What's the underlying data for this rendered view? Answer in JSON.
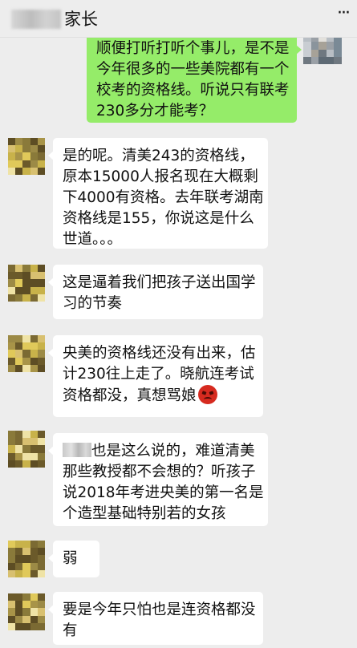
{
  "header": {
    "title": "家长",
    "more_label": "···"
  },
  "messages": [
    {
      "type": "sent",
      "lines": [
        "顺便打听打听个事儿，是不是",
        "今年很多的一些美院都有一个",
        "校考的资格线。听说只有联考",
        "230多分才能考？"
      ]
    },
    {
      "type": "received",
      "lines": [
        "是的呢。清美243的资格线，",
        "原本15000人报名现在大概剩",
        "下4000有资格。去年联考湖南",
        "资格线是155，你说这是什么",
        "世道。。。"
      ]
    },
    {
      "type": "received",
      "lines": [
        "这是逼着我们把孩子送出国学",
        "习的节奏"
      ]
    },
    {
      "type": "received",
      "lines": [
        "央美的资格线还没有出来，估",
        "计230往上走了。晓航连考试",
        "资格都没，真想骂娘"
      ],
      "emoji": "angry-face"
    },
    {
      "type": "received",
      "lines": [
        "也是这么说的，难道清美",
        "那些教授都不会想的？听孩子",
        "说2018年考进央美的第一名是",
        "个造型基础特别若的女孩"
      ]
    },
    {
      "type": "received",
      "lines": [
        "弱"
      ]
    },
    {
      "type": "received",
      "lines": [
        "要是今年只怕也是连资格都没",
        "有"
      ]
    }
  ],
  "colors": {
    "background": "#ededed",
    "sent_bubble": "#95ec69",
    "received_bubble": "#ffffff"
  }
}
